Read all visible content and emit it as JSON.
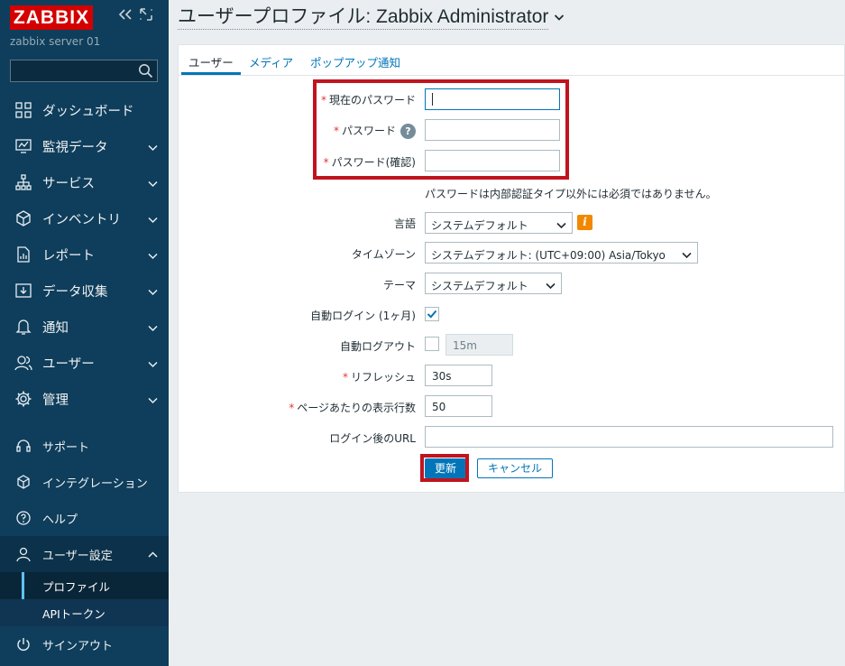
{
  "sidebar": {
    "logo": "ZABBIX",
    "server_name": "zabbix server 01",
    "search_placeholder": "",
    "menu": [
      {
        "label": "ダッシュボード",
        "icon": "dashboard-icon"
      },
      {
        "label": "監視データ",
        "icon": "monitoring-icon"
      },
      {
        "label": "サービス",
        "icon": "services-icon"
      },
      {
        "label": "インベントリ",
        "icon": "inventory-icon"
      },
      {
        "label": "レポート",
        "icon": "reports-icon"
      },
      {
        "label": "データ収集",
        "icon": "data-collection-icon"
      },
      {
        "label": "通知",
        "icon": "alerts-icon"
      },
      {
        "label": "ユーザー",
        "icon": "users-icon"
      },
      {
        "label": "管理",
        "icon": "administration-icon"
      }
    ],
    "secondary": [
      {
        "label": "サポート",
        "icon": "support-icon"
      },
      {
        "label": "インテグレーション",
        "icon": "integrations-icon"
      },
      {
        "label": "ヘルプ",
        "icon": "help-icon"
      }
    ],
    "user_settings": {
      "label": "ユーザー設定",
      "items": [
        "プロファイル",
        "APIトークン"
      ]
    },
    "signout": "サインアウト"
  },
  "header": {
    "title": "ユーザープロファイル: Zabbix Administrator"
  },
  "tabs": [
    "ユーザー",
    "メディア",
    "ポップアップ通知"
  ],
  "form": {
    "current_password_label": "現在のパスワード",
    "password_label": "パスワード",
    "password_confirm_label": "パスワード(確認)",
    "password_hint": "パスワードは内部認証タイプ以外には必須ではありません。",
    "language_label": "言語",
    "language_value": "システムデフォルト",
    "timezone_label": "タイムゾーン",
    "timezone_value": "システムデフォルト: (UTC+09:00) Asia/Tokyo",
    "theme_label": "テーマ",
    "theme_value": "システムデフォルト",
    "autologin_label": "自動ログイン (1ヶ月)",
    "autologin_checked": true,
    "autologout_label": "自動ログアウト",
    "autologout_checked": false,
    "autologout_value": "15m",
    "refresh_label": "リフレッシュ",
    "refresh_value": "30s",
    "rows_label": "ページあたりの表示行数",
    "rows_value": "50",
    "url_label": "ログイン後のURL",
    "url_value": "",
    "update_button": "更新",
    "cancel_button": "キャンセル",
    "required_mark": "*",
    "help_mark": "?",
    "info_mark": "i"
  },
  "colors": {
    "sidebar_bg": "#0e3e5c",
    "accent": "#0275b8",
    "logo_bg": "#d40000",
    "highlight": "#c0141e"
  }
}
